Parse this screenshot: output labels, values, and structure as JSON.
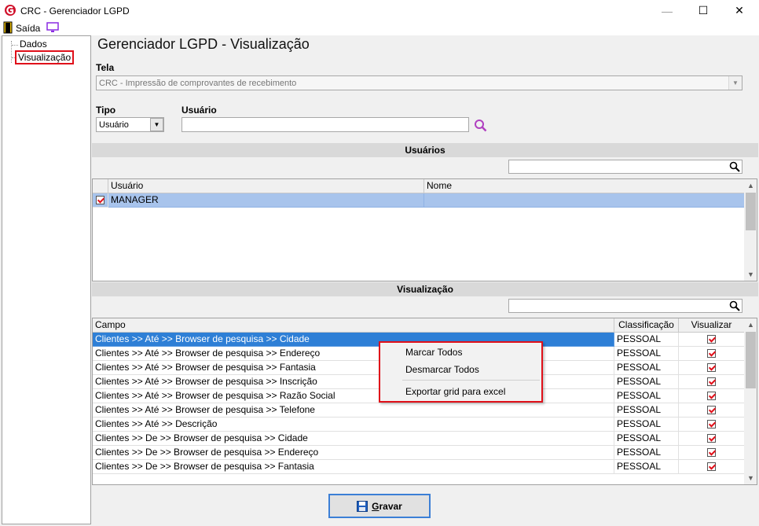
{
  "window": {
    "title": "CRC - Gerenciador LGPD",
    "min_glyph": "—",
    "max_glyph": "☐",
    "close_glyph": "✕"
  },
  "menubar": {
    "exit_label": "Saída"
  },
  "tree": {
    "items": [
      {
        "label": "Dados"
      },
      {
        "label": "Visualização",
        "selected": true
      }
    ]
  },
  "main": {
    "title": "Gerenciador LGPD - Visualização",
    "tela_label": "Tela",
    "tela_value": "CRC - Impressão de comprovantes de recebimento",
    "tipo_label": "Tipo",
    "tipo_value": "Usuário",
    "usuario_label": "Usuário",
    "usuario_value": ""
  },
  "usuarios_section": {
    "title": "Usuários",
    "search_value": "",
    "columns": [
      "Usuário",
      "Nome"
    ],
    "rows": [
      {
        "checked": true,
        "usuario": "MANAGER",
        "nome": ""
      }
    ]
  },
  "visualizacao_section": {
    "title": "Visualização",
    "search_value": "",
    "columns": [
      "Campo",
      "Classificação",
      "Visualizar"
    ],
    "rows": [
      {
        "campo": "Clientes >> Até >> Browser de pesquisa >> Cidade",
        "classificacao": "PESSOAL",
        "visualizar": true
      },
      {
        "campo": "Clientes >> Até >> Browser de pesquisa >> Endereço",
        "classificacao": "PESSOAL",
        "visualizar": true
      },
      {
        "campo": "Clientes >> Até >> Browser de pesquisa >> Fantasia",
        "classificacao": "PESSOAL",
        "visualizar": true
      },
      {
        "campo": "Clientes >> Até >> Browser de pesquisa >> Inscrição",
        "classificacao": "PESSOAL",
        "visualizar": true
      },
      {
        "campo": "Clientes >> Até >> Browser de pesquisa >> Razão Social",
        "classificacao": "PESSOAL",
        "visualizar": true
      },
      {
        "campo": "Clientes >> Até >> Browser de pesquisa >> Telefone",
        "classificacao": "PESSOAL",
        "visualizar": true
      },
      {
        "campo": "Clientes >> Até >> Descrição",
        "classificacao": "PESSOAL",
        "visualizar": true
      },
      {
        "campo": "Clientes >> De >> Browser de pesquisa >> Cidade",
        "classificacao": "PESSOAL",
        "visualizar": true
      },
      {
        "campo": "Clientes >> De >> Browser de pesquisa >> Endereço",
        "classificacao": "PESSOAL",
        "visualizar": true
      },
      {
        "campo": "Clientes >> De >> Browser de pesquisa >> Fantasia",
        "classificacao": "PESSOAL",
        "visualizar": true
      }
    ]
  },
  "context_menu": {
    "items": [
      "Marcar Todos",
      "Desmarcar Todos",
      "Exportar grid para excel"
    ]
  },
  "footer": {
    "save_label_underlined": "G",
    "save_label_rest": "ravar"
  },
  "colors": {
    "accent_red": "#e0101a",
    "selection_blue": "#2e7fd6",
    "focus_blue": "#3b7fd6"
  },
  "icons": [
    "app-logo-icon",
    "exit-door-icon",
    "monitor-icon",
    "search-icon",
    "save-floppy-icon",
    "dropdown-arrow-icon",
    "scroll-up-icon",
    "scroll-down-icon"
  ]
}
